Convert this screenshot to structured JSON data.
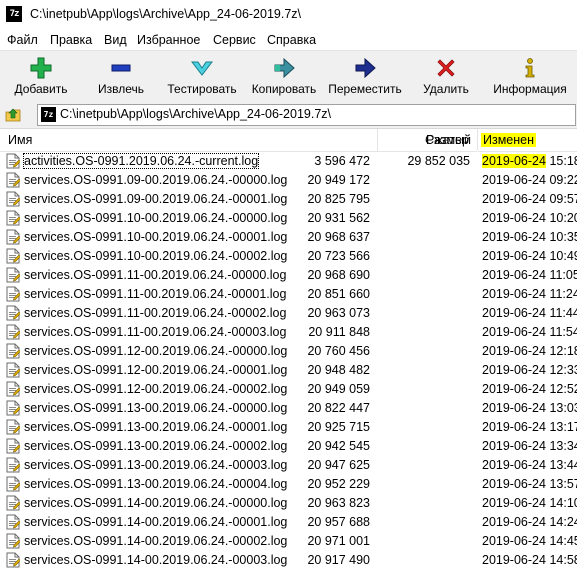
{
  "window": {
    "title": "C:\\inetpub\\App\\logs\\Archive\\App_24-06-2019.7z\\",
    "app_icon": "7z"
  },
  "menu": [
    "Файл",
    "Правка",
    "Вид",
    "Избранное",
    "Сервис",
    "Справка"
  ],
  "toolbar": [
    {
      "label": "Добавить",
      "icon": "plus-icon",
      "color": "#22b14c"
    },
    {
      "label": "Извлечь",
      "icon": "minus-icon",
      "color": "#1f3fbf"
    },
    {
      "label": "Тестировать",
      "icon": "test-chevron-icon",
      "color": "#4ad0e0"
    },
    {
      "label": "Копировать",
      "icon": "copy-arrow-icon",
      "color": "#3a8fa0"
    },
    {
      "label": "Переместить",
      "icon": "move-arrow-icon",
      "color": "#1f2f8f"
    },
    {
      "label": "Удалить",
      "icon": "delete-x-icon",
      "color": "#e02020"
    },
    {
      "label": "Информация",
      "icon": "info-icon",
      "color": "#d4b000"
    }
  ],
  "address": {
    "path": "C:\\inetpub\\App\\logs\\Archive\\App_24-06-2019.7z\\"
  },
  "columns": {
    "name": "Имя",
    "size": "Размер",
    "packed": "Сжатый",
    "modified": "Изменен"
  },
  "files": [
    {
      "name": "activities.OS-0991.2019.06.24.-current.log",
      "size": "3 596 472",
      "packed": "29 852 035",
      "date": "2019-06-24",
      "time": "15:18"
    },
    {
      "name": "services.OS-0991.09-00.2019.06.24.-00000.log",
      "size": "20 949 172",
      "packed": "",
      "date": "2019-06-24",
      "time": "09:22"
    },
    {
      "name": "services.OS-0991.09-00.2019.06.24.-00001.log",
      "size": "20 825 795",
      "packed": "",
      "date": "2019-06-24",
      "time": "09:57"
    },
    {
      "name": "services.OS-0991.10-00.2019.06.24.-00000.log",
      "size": "20 931 562",
      "packed": "",
      "date": "2019-06-24",
      "time": "10:20"
    },
    {
      "name": "services.OS-0991.10-00.2019.06.24.-00001.log",
      "size": "20 968 637",
      "packed": "",
      "date": "2019-06-24",
      "time": "10:35"
    },
    {
      "name": "services.OS-0991.10-00.2019.06.24.-00002.log",
      "size": "20 723 566",
      "packed": "",
      "date": "2019-06-24",
      "time": "10:49"
    },
    {
      "name": "services.OS-0991.11-00.2019.06.24.-00000.log",
      "size": "20 968 690",
      "packed": "",
      "date": "2019-06-24",
      "time": "11:05"
    },
    {
      "name": "services.OS-0991.11-00.2019.06.24.-00001.log",
      "size": "20 851 660",
      "packed": "",
      "date": "2019-06-24",
      "time": "11:24"
    },
    {
      "name": "services.OS-0991.11-00.2019.06.24.-00002.log",
      "size": "20 963 073",
      "packed": "",
      "date": "2019-06-24",
      "time": "11:44"
    },
    {
      "name": "services.OS-0991.11-00.2019.06.24.-00003.log",
      "size": "20 911 848",
      "packed": "",
      "date": "2019-06-24",
      "time": "11:54"
    },
    {
      "name": "services.OS-0991.12-00.2019.06.24.-00000.log",
      "size": "20 760 456",
      "packed": "",
      "date": "2019-06-24",
      "time": "12:18"
    },
    {
      "name": "services.OS-0991.12-00.2019.06.24.-00001.log",
      "size": "20 948 482",
      "packed": "",
      "date": "2019-06-24",
      "time": "12:33"
    },
    {
      "name": "services.OS-0991.12-00.2019.06.24.-00002.log",
      "size": "20 949 059",
      "packed": "",
      "date": "2019-06-24",
      "time": "12:52"
    },
    {
      "name": "services.OS-0991.13-00.2019.06.24.-00000.log",
      "size": "20 822 447",
      "packed": "",
      "date": "2019-06-24",
      "time": "13:03"
    },
    {
      "name": "services.OS-0991.13-00.2019.06.24.-00001.log",
      "size": "20 925 715",
      "packed": "",
      "date": "2019-06-24",
      "time": "13:17"
    },
    {
      "name": "services.OS-0991.13-00.2019.06.24.-00002.log",
      "size": "20 942 545",
      "packed": "",
      "date": "2019-06-24",
      "time": "13:34"
    },
    {
      "name": "services.OS-0991.13-00.2019.06.24.-00003.log",
      "size": "20 947 625",
      "packed": "",
      "date": "2019-06-24",
      "time": "13:44"
    },
    {
      "name": "services.OS-0991.13-00.2019.06.24.-00004.log",
      "size": "20 952 229",
      "packed": "",
      "date": "2019-06-24",
      "time": "13:57"
    },
    {
      "name": "services.OS-0991.14-00.2019.06.24.-00000.log",
      "size": "20 963 823",
      "packed": "",
      "date": "2019-06-24",
      "time": "14:10"
    },
    {
      "name": "services.OS-0991.14-00.2019.06.24.-00001.log",
      "size": "20 957 688",
      "packed": "",
      "date": "2019-06-24",
      "time": "14:24"
    },
    {
      "name": "services.OS-0991.14-00.2019.06.24.-00002.log",
      "size": "20 971 001",
      "packed": "",
      "date": "2019-06-24",
      "time": "14:45"
    },
    {
      "name": "services.OS-0991.14-00.2019.06.24.-00003.log",
      "size": "20 917 490",
      "packed": "",
      "date": "2019-06-24",
      "time": "14:58"
    }
  ]
}
